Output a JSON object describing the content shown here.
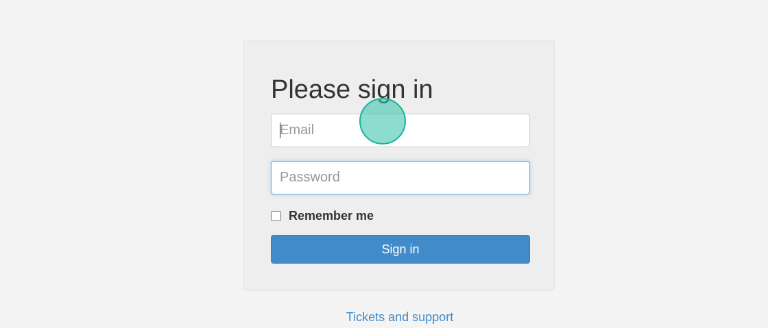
{
  "login": {
    "title": "Please sign in",
    "email_placeholder": "Email",
    "password_placeholder": "Password",
    "remember_label": "Remember me",
    "remember_checked": false,
    "submit_label": "Sign in"
  },
  "footer": {
    "support_link": "Tickets and support"
  },
  "colors": {
    "primary": "#428bca",
    "focus_border": "#66afe9",
    "click_marker": "#1ab394"
  }
}
